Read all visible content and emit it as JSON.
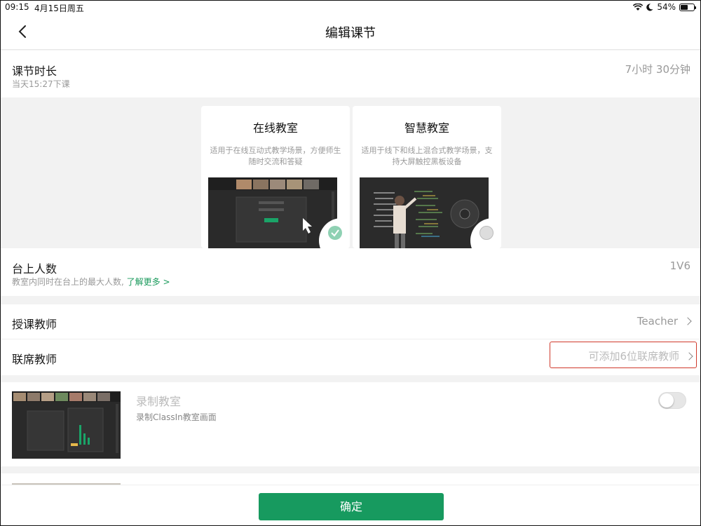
{
  "status_bar": {
    "time": "09:15",
    "date": "4月15日周五",
    "battery": "54%"
  },
  "nav": {
    "title": "编辑课节"
  },
  "duration": {
    "label": "课节时长",
    "sub": "当天15:27下课",
    "value": "7小时 30分钟"
  },
  "modes": [
    {
      "title": "在线教室",
      "desc": "适用于在线互动式教学场景，方便师生随时交流和答疑",
      "selected": true
    },
    {
      "title": "智慧教室",
      "desc": "适用于线下和线上混合式教学场景，支持大屏触控黑板设备",
      "selected": false
    }
  ],
  "seats": {
    "label": "台上人数",
    "sub": "教室内同时在台上的最大人数,",
    "link": "了解更多 >",
    "value": "1V6"
  },
  "teacher": {
    "label": "授课教师",
    "value": "Teacher"
  },
  "co_teacher": {
    "label": "联席教师",
    "value": "可添加6位联席教师"
  },
  "record": {
    "title": "录制教室",
    "desc": "录制ClassIn教室画面"
  },
  "confirm": {
    "label": "确定"
  },
  "colors": {
    "accent": "#179a5f",
    "highlight_border": "#d0392b"
  }
}
